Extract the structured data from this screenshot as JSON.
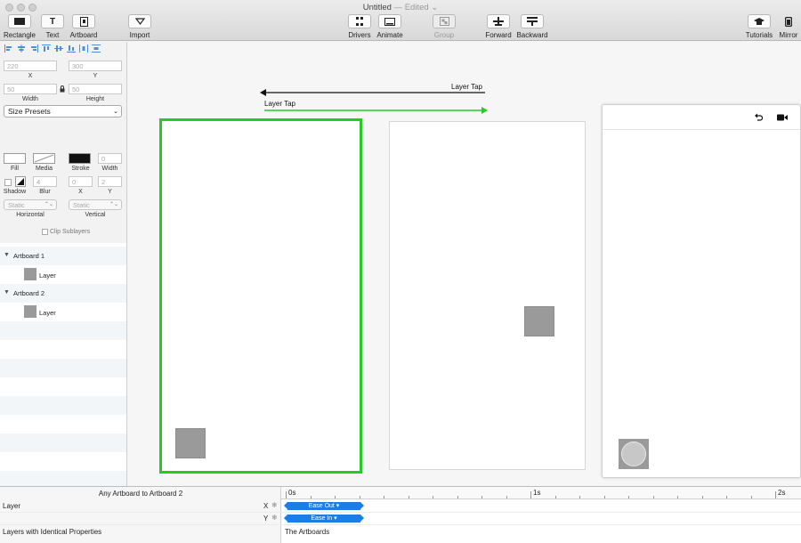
{
  "window": {
    "title": "Untitled",
    "edited": "— Edited ⌄"
  },
  "toolbar": {
    "rectangle": "Rectangle",
    "text": "Text",
    "artboard": "Artboard",
    "import": "Import",
    "drivers": "Drivers",
    "animate": "Animate",
    "group": "Group",
    "forward": "Forward",
    "backward": "Backward",
    "tutorials": "Tutorials",
    "mirror": "Mirror"
  },
  "inspector": {
    "x_value": "220",
    "y_value": "300",
    "x_label": "X",
    "y_label": "Y",
    "width_value": "50",
    "height_value": "50",
    "width_label": "Width",
    "height_label": "Height",
    "size_presets": "Size Presets",
    "fill_label": "Fill",
    "media_label": "Media",
    "stroke_label": "Stroke",
    "stroke_width_value": "0",
    "stroke_width_label": "Width",
    "shadow_label": "Shadow",
    "blur_value": "4",
    "blur_label": "Blur",
    "shadow_x_value": "0",
    "shadow_y_value": "2",
    "shadow_x_label": "X",
    "shadow_y_label": "Y",
    "horizontal_value": "Static",
    "vertical_value": "Static",
    "horizontal_label": "Horizontal",
    "vertical_label": "Vertical",
    "clip_sublayers": "Clip Sublayers"
  },
  "layers": [
    {
      "name": "Artboard 1",
      "type": "artboard"
    },
    {
      "name": "Layer",
      "type": "layer"
    },
    {
      "name": "Artboard 2",
      "type": "artboard"
    },
    {
      "name": "Layer",
      "type": "layer"
    }
  ],
  "canvas": {
    "connection_back": "Layer Tap",
    "connection_forward": "Layer Tap",
    "accent_green": "#22cc22"
  },
  "timeline": {
    "transition": "Any Artboard to Artboard 2",
    "ruler": [
      "0s",
      "1s",
      "2s"
    ],
    "layer_name": "Layer",
    "x_prop": "X",
    "y_prop": "Y",
    "x_curve": "Ease Out ▾",
    "y_curve": "Ease In ▾",
    "identical_label": "Layers with Identical Properties",
    "identical_value": "The Artboards",
    "curve_color": "#1c7de8"
  }
}
